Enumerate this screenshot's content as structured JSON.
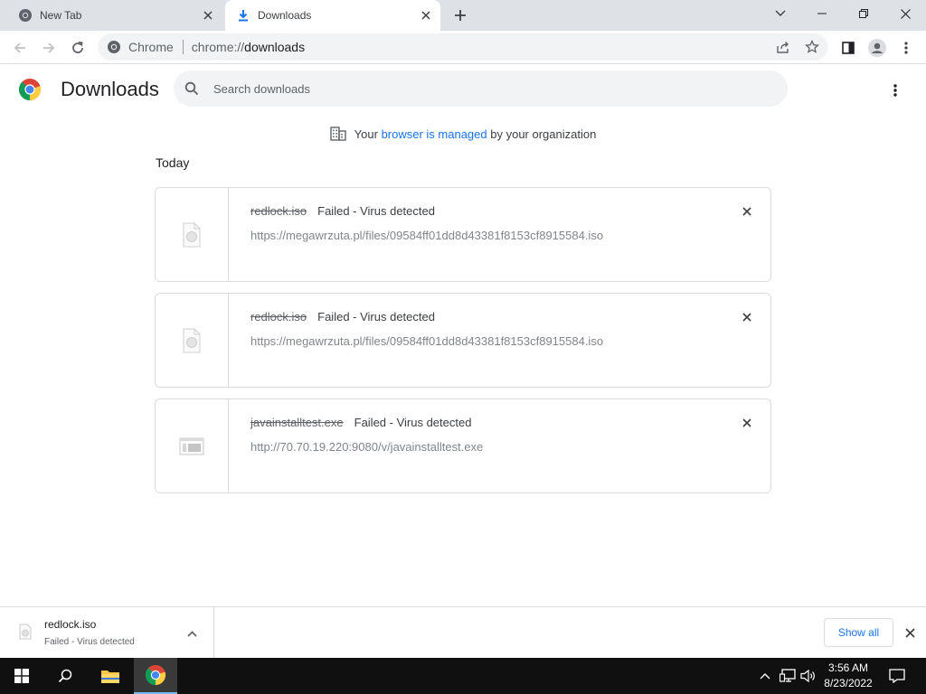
{
  "browser": {
    "tabs": [
      {
        "label": "New Tab",
        "active": false
      },
      {
        "label": "Downloads",
        "active": true
      }
    ],
    "omnibox": {
      "site_label": "Chrome",
      "url_scheme": "chrome://",
      "url_host": "downloads"
    }
  },
  "downloads_page": {
    "title": "Downloads",
    "search": {
      "placeholder": "Search downloads"
    },
    "managed_notice": {
      "prefix": "Your",
      "link": "browser is managed",
      "suffix": "by your organization"
    },
    "section_label": "Today",
    "items": [
      {
        "filename": "redlock.iso",
        "status": "Failed - Virus detected",
        "url": "https://megawrzuta.pl/files/09584ff01dd8d43381f8153cf8915584.iso",
        "icon": "file-icon"
      },
      {
        "filename": "redlock.iso",
        "status": "Failed - Virus detected",
        "url": "https://megawrzuta.pl/files/09584ff01dd8d43381f8153cf8915584.iso",
        "icon": "file-icon"
      },
      {
        "filename": "javainstalltest.exe",
        "status": "Failed - Virus detected",
        "url": "http://70.70.19.220:9080/v/javainstalltest.exe",
        "icon": "exe-icon"
      }
    ]
  },
  "shelf": {
    "item": {
      "filename": "redlock.iso",
      "status": "Failed - Virus detected"
    },
    "show_all_label": "Show all"
  },
  "taskbar": {
    "time": "3:56 AM",
    "date": "8/23/2022"
  },
  "colors": {
    "accent": "#1a73e8",
    "taskbar": "#101010",
    "tabstrip": "#dee1e6"
  }
}
